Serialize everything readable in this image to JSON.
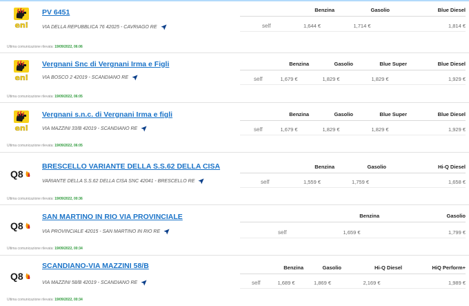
{
  "currency": "€",
  "timestamp_label": "Ultima comunicazione rilevata:",
  "service_label": "self",
  "stations": [
    {
      "brand": "eni",
      "name": "PV 6451",
      "address": "VIA DELLA REPUBBLICA 76 42025 - CAVRIAGO RE",
      "fuels": [
        "Benzina",
        "Gasolio",
        "Blue Diesel"
      ],
      "prices": [
        "1,644 €",
        "1,714 €",
        "1,814 €"
      ],
      "timestamp": "19/09/2022, 06:06"
    },
    {
      "brand": "eni",
      "name": "Vergnani Snc di Vergnani Irma e Figli",
      "address": "VIA BOSCO 2 42019 - SCANDIANO RE",
      "fuels": [
        "Benzina",
        "Gasolio",
        "Blue Super",
        "Blue Diesel"
      ],
      "prices": [
        "1,679 €",
        "1,829 €",
        "1,829 €",
        "1,929 €"
      ],
      "timestamp": "19/09/2022, 06:05"
    },
    {
      "brand": "eni",
      "name": "Vergnani s.n.c. di Vergnani Irma e figli",
      "address": "VIA MAZZINI 33/B 42019 - SCANDIANO RE",
      "fuels": [
        "Benzina",
        "Gasolio",
        "Blue Super",
        "Blue Diesel"
      ],
      "prices": [
        "1,679 €",
        "1,829 €",
        "1,829 €",
        "1,929 €"
      ],
      "timestamp": "19/09/2022, 06:05"
    },
    {
      "brand": "Q8",
      "name": "BRESCELLO VARIANTE DELLA S.S.62 DELLA CISA",
      "address": "VARIANTE DELLA S.S.62 DELLA CISA SNC 42041 - BRESCELLO RE",
      "fuels": [
        "Benzina",
        "Gasolio",
        "Hi-Q Diesel"
      ],
      "prices": [
        "1,559 €",
        "1,759 €",
        "1,658 €"
      ],
      "timestamp": "19/09/2022, 00:36"
    },
    {
      "brand": "Q8",
      "name": "SAN MARTINO IN RIO VIA PROVINCIALE",
      "address": "VIA PROVINCIALE 42015 - SAN MARTINO IN RIO RE",
      "fuels": [
        "Benzina",
        "Gasolio"
      ],
      "prices": [
        "1,659 €",
        "1,799 €"
      ],
      "timestamp": "19/09/2022, 00:34"
    },
    {
      "brand": "Q8",
      "name": "SCANDIANO-VIA MAZZINI 58/B",
      "address": "VIA MAZZINI 58/B 42019 - SCANDIANO RE",
      "fuels": [
        "Benzina",
        "Gasolio",
        "Hi-Q Diesel",
        "HiQ Perform+"
      ],
      "prices": [
        "1,689 €",
        "1,869 €",
        "2,169 €",
        "1,989 €"
      ],
      "timestamp": "19/09/2022, 00:34"
    }
  ],
  "colors": {
    "link": "#1a73c8",
    "timestamp_date": "#2e9a3b",
    "eni_yellow": "#f7d117",
    "q8_orange": "#f39200",
    "q8_red": "#d3202b",
    "nav_arrow": "#0b3f8a"
  },
  "icons": [
    "eni-logo",
    "q8-logo",
    "navigate-arrow-icon"
  ]
}
